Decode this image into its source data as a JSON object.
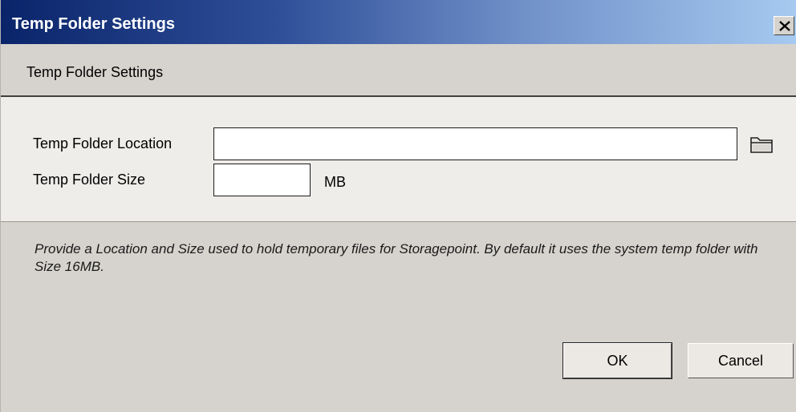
{
  "window": {
    "title": "Temp Folder Settings",
    "close_glyph": "✕"
  },
  "header": {
    "title": "Temp Folder Settings"
  },
  "form": {
    "location_label": "Temp Folder Location",
    "location_value": "",
    "browse_icon": "folder-icon",
    "size_label": "Temp Folder Size",
    "size_value": "",
    "size_unit": "MB"
  },
  "description": "Provide a Location and Size used to hold temporary files for Storagepoint. By default it uses the system temp folder with Size 16MB.",
  "buttons": {
    "ok_label": "OK",
    "cancel_label": "Cancel"
  },
  "colors": {
    "titlebar_start": "#0a246a",
    "titlebar_end": "#a6caf0",
    "dialog_background": "#d6d3ce",
    "form_background": "#efedea"
  }
}
